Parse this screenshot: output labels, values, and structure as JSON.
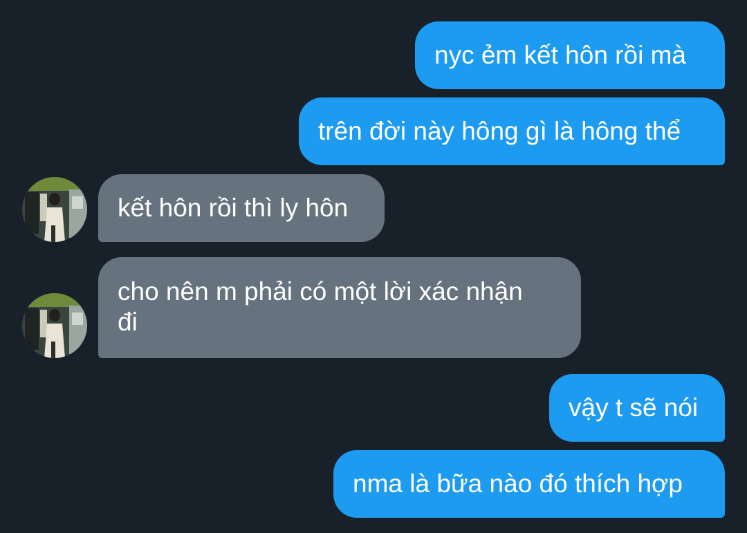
{
  "conversation": {
    "messages": [
      {
        "direction": "outgoing",
        "text": "nyc ẻm kết hôn rồi mà"
      },
      {
        "direction": "outgoing",
        "text": "trên đời này hông gì là hông thể"
      },
      {
        "direction": "incoming",
        "text": "kết hôn rồi thì ly hôn"
      },
      {
        "direction": "incoming",
        "text": "cho nên m phải có một lời xác nhận\nđi"
      },
      {
        "direction": "outgoing",
        "text": "vậy t sẽ nói"
      },
      {
        "direction": "outgoing",
        "text": "nma là bữa nào đó thích hợp"
      }
    ]
  },
  "colors": {
    "background": "#18202a",
    "outgoing_bubble": "#1d9bf0",
    "incoming_bubble": "#66737f",
    "text": "#ffffff"
  }
}
